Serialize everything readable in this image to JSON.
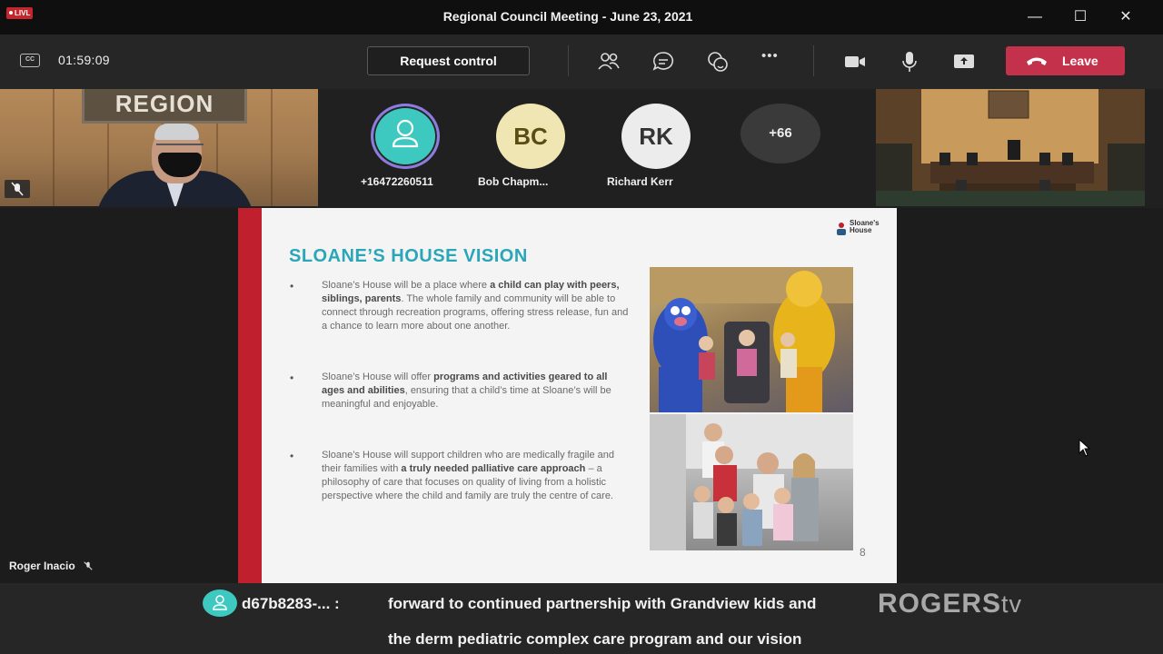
{
  "window": {
    "live_badge": "LIVL",
    "title": "Regional Council Meeting - June 23, 2021",
    "controls": {
      "minimize": "—",
      "maximize": "☐",
      "close": "✕"
    }
  },
  "toolbar": {
    "timer": "01:59:09",
    "cc_label": "CC",
    "request_control_label": "Request control",
    "icons": [
      "people-icon",
      "chat-icon",
      "reactions-icon",
      "more-icon",
      "camera-icon",
      "microphone-icon",
      "share-icon"
    ],
    "more_label": "•••",
    "leave_label": "Leave",
    "leave_color": "#c4314b"
  },
  "participants": {
    "tiles": [
      {
        "name": "Roger Inacio"
      },
      {
        "name": "+16472260511",
        "initials": "",
        "color": "#3ec9c0"
      },
      {
        "name": "Bob Chapm...",
        "initials": "BC",
        "color": "#efe6b4"
      },
      {
        "name": "Richard Kerr",
        "initials": "RK",
        "color": "#ececec"
      }
    ],
    "overflow": "+66",
    "region_sign": "REGION"
  },
  "slide": {
    "title": "SLOANE’S HOUSE VISION",
    "logo_text": "Sloane's House",
    "bullets": [
      "•",
      "•",
      "•"
    ],
    "page_number": "8"
  },
  "caption": {
    "speaker": "d67b8283-...  :",
    "line1": "forward to continued partnership with Grandview kids and",
    "line2": "the derm pediatric complex care program and our vision"
  },
  "watermark": {
    "brand": "ROGERS",
    "suffix": "tv"
  }
}
